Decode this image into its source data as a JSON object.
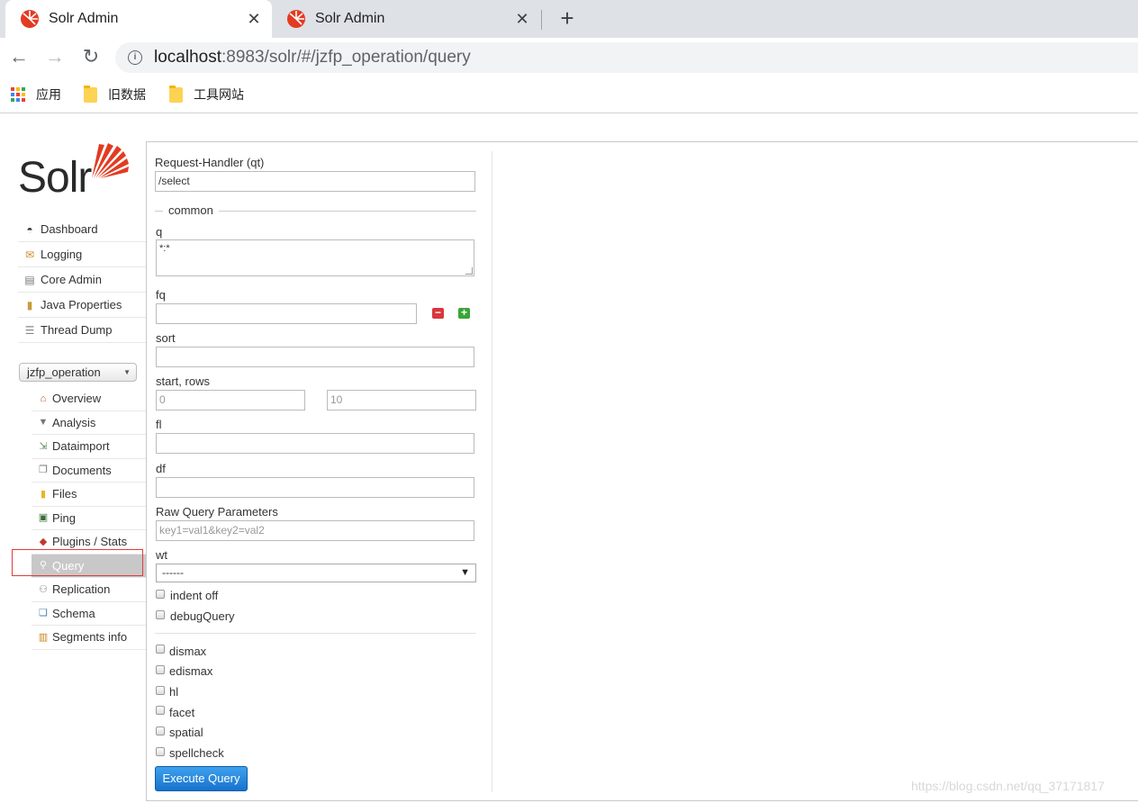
{
  "browser": {
    "tabs": [
      {
        "title": "Solr Admin",
        "active": true
      },
      {
        "title": "Solr Admin",
        "active": false
      }
    ],
    "new_tab_label": "+",
    "url_host": "localhost",
    "url_rest": ":8983/solr/#/jzfp_operation/query",
    "bookmarks": [
      {
        "label": "应用",
        "icon": "apps-grid-icon"
      },
      {
        "label": "旧数据",
        "icon": "folder-icon"
      },
      {
        "label": "工具网站",
        "icon": "folder-icon"
      }
    ]
  },
  "logo_text": "Solr",
  "sidebar": {
    "items": [
      {
        "label": "Dashboard",
        "icon": "dashboard-icon"
      },
      {
        "label": "Logging",
        "icon": "logging-icon"
      },
      {
        "label": "Core Admin",
        "icon": "core-admin-icon"
      },
      {
        "label": "Java Properties",
        "icon": "java-icon"
      },
      {
        "label": "Thread Dump",
        "icon": "thread-dump-icon"
      }
    ],
    "core_selector": "jzfp_operation",
    "core_items": [
      {
        "label": "Overview",
        "icon": "home-icon"
      },
      {
        "label": "Analysis",
        "icon": "filter-icon"
      },
      {
        "label": "Dataimport",
        "icon": "dataimport-icon"
      },
      {
        "label": "Documents",
        "icon": "documents-icon"
      },
      {
        "label": "Files",
        "icon": "folder-icon"
      },
      {
        "label": "Ping",
        "icon": "ping-icon"
      },
      {
        "label": "Plugins / Stats",
        "icon": "plugins-icon"
      },
      {
        "label": "Query",
        "icon": "magnifier-icon",
        "active": true
      },
      {
        "label": "Replication",
        "icon": "replication-icon"
      },
      {
        "label": "Schema",
        "icon": "schema-icon"
      },
      {
        "label": "Segments info",
        "icon": "segments-icon"
      }
    ]
  },
  "form": {
    "request_handler_label": "Request-Handler (qt)",
    "request_handler_value": "/select",
    "common_legend": "common",
    "q_label": "q",
    "q_value": "*:*",
    "fq_label": "fq",
    "fq_value": "",
    "sort_label": "sort",
    "sort_value": "",
    "start_rows_label": "start, rows",
    "start_placeholder": "0",
    "rows_placeholder": "10",
    "fl_label": "fl",
    "fl_value": "",
    "df_label": "df",
    "df_value": "",
    "raw_label": "Raw Query Parameters",
    "raw_placeholder": "key1=val1&key2=val2",
    "wt_label": "wt",
    "wt_value": "------",
    "checkboxes_common": [
      {
        "label": "indent off",
        "checked": false
      },
      {
        "label": "debugQuery",
        "checked": false
      }
    ],
    "checkboxes_extra": [
      {
        "label": "dismax",
        "checked": false
      },
      {
        "label": "edismax",
        "checked": false
      },
      {
        "label": "hl",
        "checked": false
      },
      {
        "label": "facet",
        "checked": false
      },
      {
        "label": "spatial",
        "checked": false
      },
      {
        "label": "spellcheck",
        "checked": false
      }
    ],
    "execute_label": "Execute Query"
  },
  "watermark": "https://blog.csdn.net/qq_37171817"
}
